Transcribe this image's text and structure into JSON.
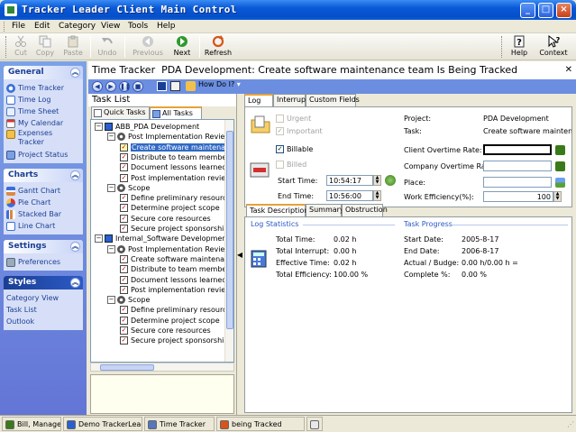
{
  "window": {
    "title": "Tracker Leader Client Main Control"
  },
  "menu": [
    "File",
    "Edit",
    "Category",
    "View",
    "Tools",
    "Help"
  ],
  "toolbar": {
    "cut": "Cut",
    "copy": "Copy",
    "paste": "Paste",
    "undo": "Undo",
    "previous": "Previous",
    "next": "Next",
    "refresh": "Refresh",
    "help": "Help",
    "context": "Context"
  },
  "sidebar": {
    "general": {
      "title": "General",
      "items": [
        "Time Tracker",
        "Time Log",
        "Time Sheet",
        "My Calendar",
        "Expenses Tracker",
        "Project Status"
      ]
    },
    "charts": {
      "title": "Charts",
      "items": [
        "Gantt Chart",
        "Pie Chart",
        "Stacked Bar",
        "Line Chart"
      ]
    },
    "settings": {
      "title": "Settings",
      "items": [
        "Preferences"
      ]
    },
    "styles": {
      "title": "Styles",
      "items": [
        "Category View",
        "Task List",
        "Outlook"
      ]
    }
  },
  "header": {
    "module": "Time Tracker",
    "subtitle": "PDA Development: Create software maintenance team Is Being Tracked",
    "how_do_i": "How Do I?"
  },
  "tasklist": {
    "title": "Task List",
    "tabs": [
      "Quick Tasks",
      "All Tasks"
    ],
    "tree": [
      {
        "level": 0,
        "kind": "project",
        "label": "ABB_PDA Development"
      },
      {
        "level": 1,
        "kind": "group",
        "label": "Post Implementation Review"
      },
      {
        "level": 2,
        "kind": "task",
        "label": "Create software maintenance team",
        "selected": true
      },
      {
        "level": 2,
        "kind": "task",
        "label": "Distribute to team members"
      },
      {
        "level": 2,
        "kind": "task",
        "label": "Document lessons learned"
      },
      {
        "level": 2,
        "kind": "task",
        "label": "Post implementation review"
      },
      {
        "level": 1,
        "kind": "group",
        "label": "Scope"
      },
      {
        "level": 2,
        "kind": "task",
        "label": "Define preliminary resources"
      },
      {
        "level": 2,
        "kind": "task",
        "label": "Determine project scope"
      },
      {
        "level": 2,
        "kind": "task",
        "label": "Secure core resources"
      },
      {
        "level": 2,
        "kind": "task",
        "label": "Secure project sponsorship"
      },
      {
        "level": 0,
        "kind": "project",
        "label": "Internal_Software Development"
      },
      {
        "level": 1,
        "kind": "group",
        "label": "Post Implementation Review"
      },
      {
        "level": 2,
        "kind": "task",
        "label": "Create software maintenance team"
      },
      {
        "level": 2,
        "kind": "task",
        "label": "Distribute to team members"
      },
      {
        "level": 2,
        "kind": "task",
        "label": "Document lessons learned"
      },
      {
        "level": 2,
        "kind": "task",
        "label": "Post implementation review"
      },
      {
        "level": 1,
        "kind": "group",
        "label": "Scope"
      },
      {
        "level": 2,
        "kind": "task",
        "label": "Define preliminary resources"
      },
      {
        "level": 2,
        "kind": "task",
        "label": "Determine project scope"
      },
      {
        "level": 2,
        "kind": "task",
        "label": "Secure core resources"
      },
      {
        "level": 2,
        "kind": "task",
        "label": "Secure project sponsorship"
      }
    ]
  },
  "log": {
    "tabs": [
      "Log",
      "Interrupt",
      "Custom Fields"
    ],
    "urgent": "Urgent",
    "important": "Important",
    "billable": "Billable",
    "billed": "Billed",
    "start_time_label": "Start Time:",
    "start_time": "10:54:17",
    "end_time_label": "End Time:",
    "end_time": "10:56:00",
    "project_label": "Project:",
    "project": "PDA Development",
    "task_label": "Task:",
    "task": "Create software maintenance team",
    "client_ot_label": "Client Overtime Rate:",
    "client_ot": "",
    "company_ot_label": "Company Overtime Rate:",
    "company_ot": "",
    "place_label": "Place:",
    "place": "",
    "efficiency_label": "Work Efficiency(%):",
    "efficiency": "100"
  },
  "task_tabs": [
    "Task Description",
    "Summary",
    "Obstruction"
  ],
  "stats": {
    "heading": "Log Statistics",
    "rows": [
      {
        "label": "Total Time:",
        "value": "0.02 h"
      },
      {
        "label": "Total Interrupt:",
        "value": "0.00 h"
      },
      {
        "label": "Effective Time:",
        "value": "0.02 h"
      },
      {
        "label": "Total Efficiency:",
        "value": "100.00 %"
      }
    ]
  },
  "progress": {
    "heading": "Task Progress",
    "rows": [
      {
        "label": "Start Date:",
        "value": "2005-8-17"
      },
      {
        "label": "End Date:",
        "value": "2006-8-17"
      },
      {
        "label": "Actual / Budge:",
        "value": "0.00 h/0.00 h ="
      },
      {
        "label": "Complete %:",
        "value": "0.00 %"
      }
    ]
  },
  "statusbar": [
    "Bill, Manager",
    "Demo TrackerLeaderV",
    "Time Tracker",
    "being Tracked",
    ""
  ]
}
